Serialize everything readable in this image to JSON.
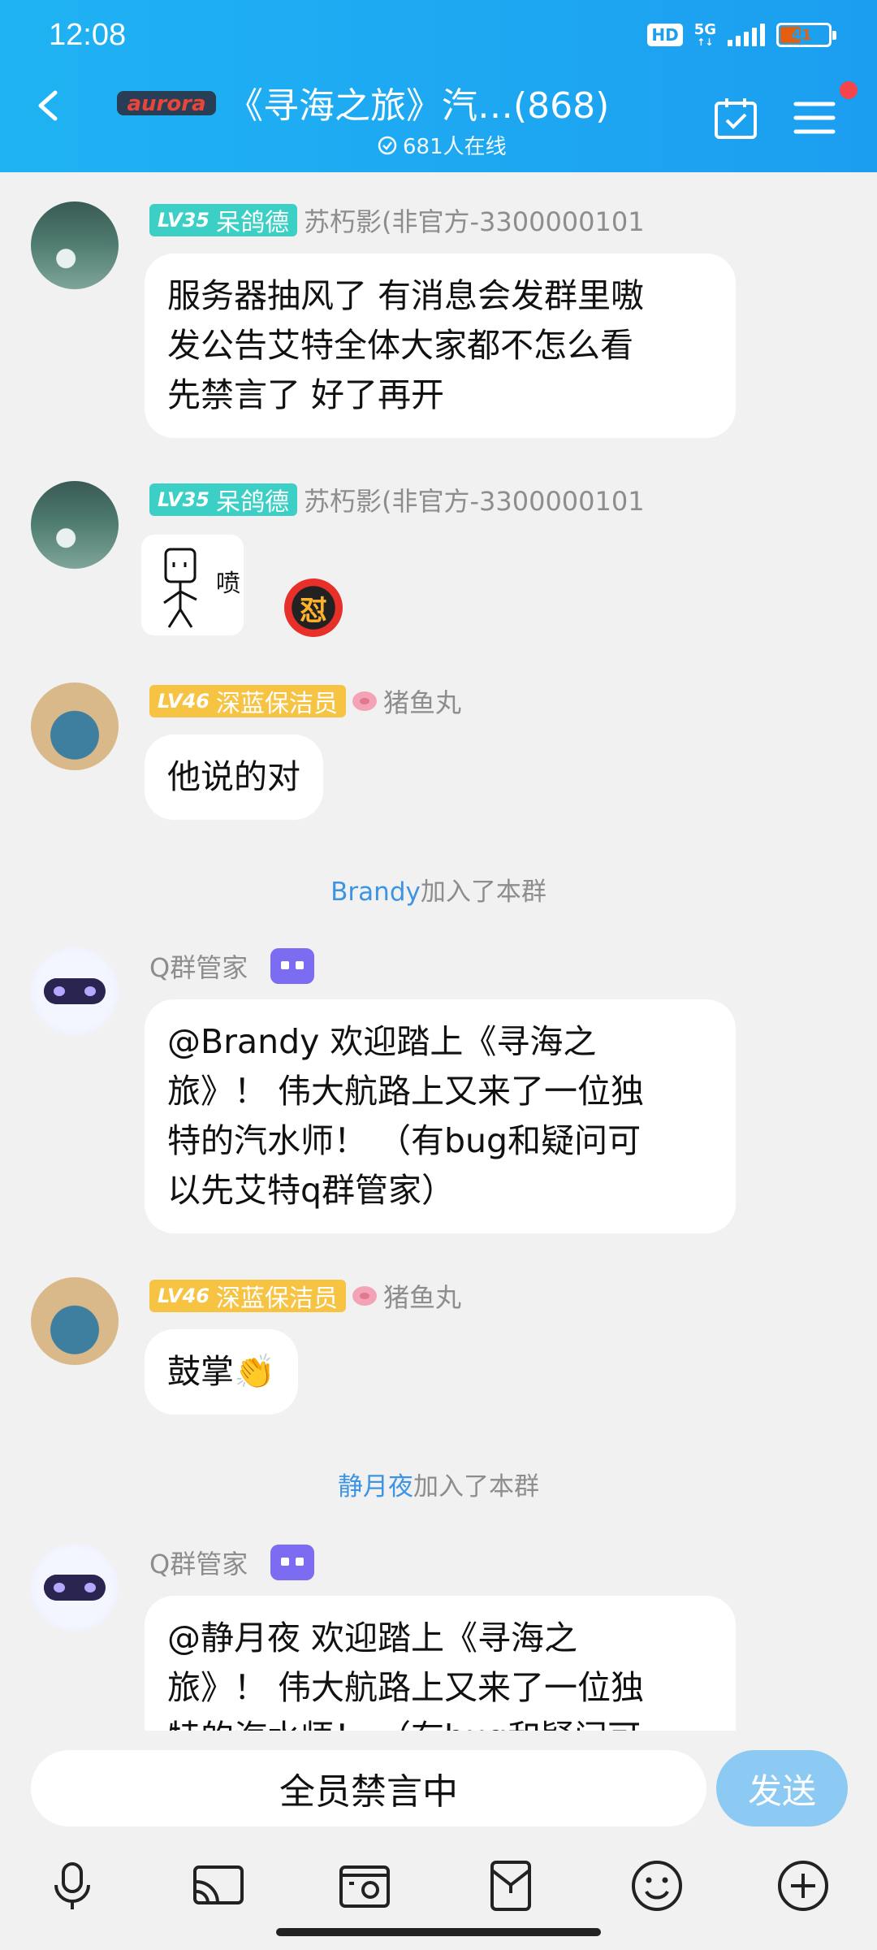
{
  "status_bar": {
    "time": "12:08",
    "hd": "HD",
    "network": "5G",
    "battery": "41"
  },
  "header": {
    "title": "《寻海之旅》汽…(868)",
    "online": "681人在线",
    "logo_text": "aurora"
  },
  "messages": [
    {
      "level": "LV35",
      "title": "呆鸽德",
      "name": "苏朽影(非官方-3300000101",
      "text_lines": [
        "服务器抽风了 有消息会发群里嗷",
        "发公告艾特全体大家都不怎么看",
        "先禁言了 好了再开"
      ]
    },
    {
      "level": "LV35",
      "title": "呆鸽德",
      "name": "苏朽影(非官方-3300000101",
      "sticker_text": "喷",
      "emoji_text": "怼"
    },
    {
      "level": "LV46",
      "title": "深蓝保洁员",
      "name": "猪鱼丸",
      "text": "他说的对"
    },
    {
      "system_user": "Brandy",
      "system_text": "加入了本群"
    },
    {
      "name": "Q群管家",
      "text_lines": [
        "@Brandy 欢迎踏上《寻海之",
        "旅》！ 伟大航路上又来了一位独",
        "特的汽水师！ （有bug和疑问可",
        "以先艾特q群管家）"
      ]
    },
    {
      "level": "LV46",
      "title": "深蓝保洁员",
      "name": "猪鱼丸",
      "text": "鼓掌",
      "emoji": "👏"
    },
    {
      "system_user": "静月夜",
      "system_text": "加入了本群"
    },
    {
      "name": "Q群管家",
      "text_lines": [
        "@静月夜 欢迎踏上《寻海之",
        "旅》！ 伟大航路上又来了一位独",
        "特的汽水师！ （有bug和疑问可"
      ]
    }
  ],
  "input": {
    "placeholder": "全员禁言中",
    "send_label": "发送"
  },
  "toolbar_icons": [
    "microphone-icon",
    "screen-cast-icon",
    "image-icon",
    "red-packet-icon",
    "emoji-icon",
    "plus-icon"
  ],
  "colors": {
    "header": "#1fb3f3",
    "accent": "#3d94e3",
    "send": "#8dcaf3",
    "notify_dot": "#f4444d"
  }
}
